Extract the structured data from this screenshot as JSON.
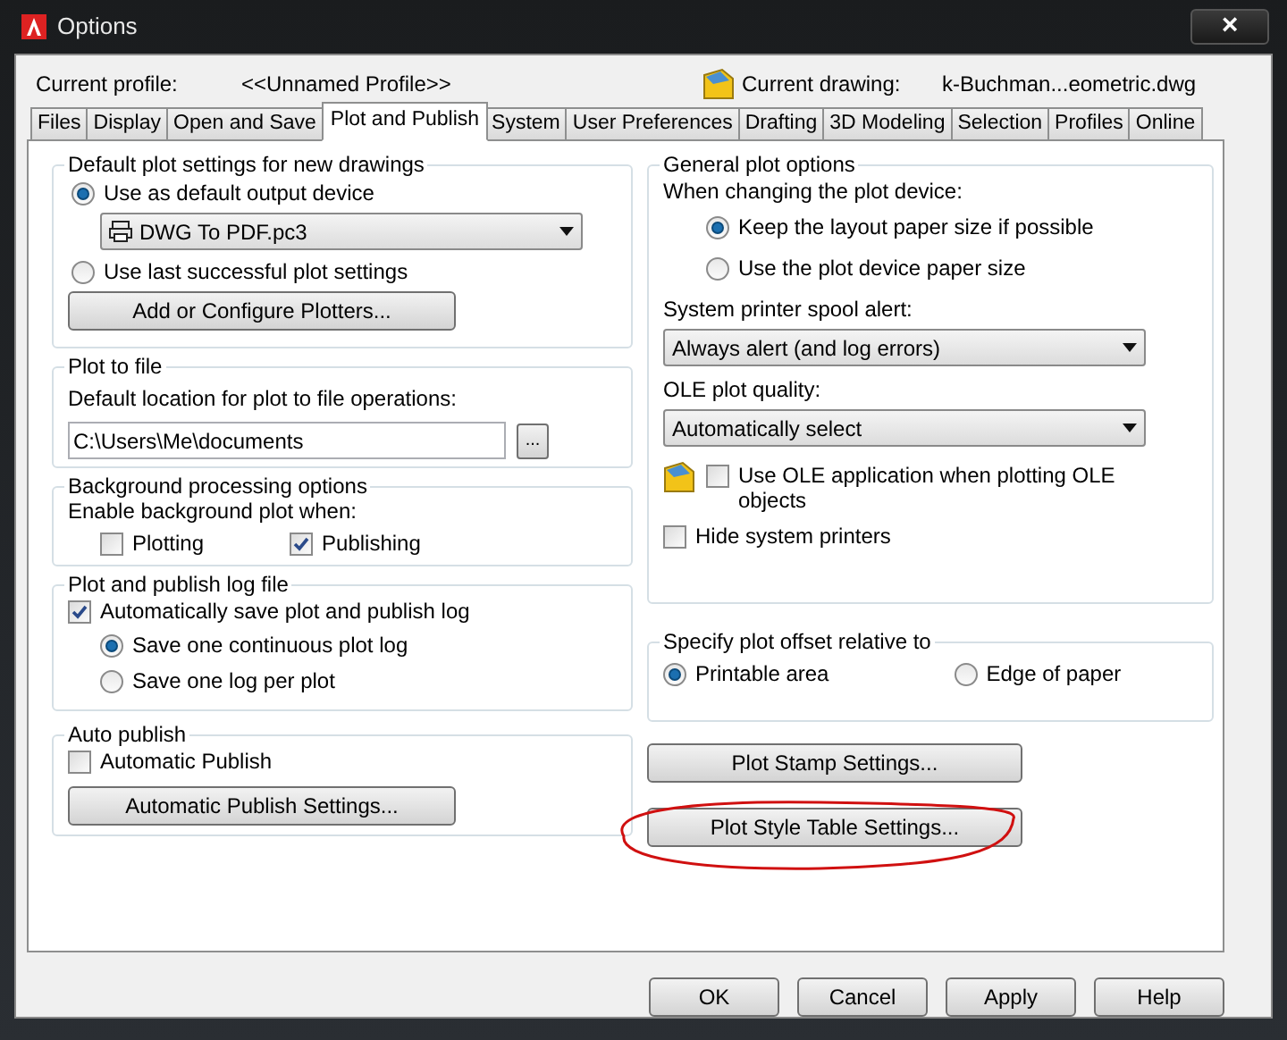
{
  "window": {
    "title": "Options",
    "close": "×"
  },
  "profile": {
    "label": "Current profile:",
    "value": "<<Unnamed Profile>>"
  },
  "drawing": {
    "label": "Current drawing:",
    "value": "k-Buchman...eometric.dwg"
  },
  "tabs": [
    {
      "label": "Files",
      "selected": false
    },
    {
      "label": "Display",
      "selected": false
    },
    {
      "label": "Open and Save",
      "selected": false
    },
    {
      "label": "Plot and Publish",
      "selected": true
    },
    {
      "label": "System",
      "selected": false
    },
    {
      "label": "User Preferences",
      "selected": false
    },
    {
      "label": "Drafting",
      "selected": false
    },
    {
      "label": "3D Modeling",
      "selected": false
    },
    {
      "label": "Selection",
      "selected": false
    },
    {
      "label": "Profiles",
      "selected": false
    },
    {
      "label": "Online",
      "selected": false
    }
  ],
  "default_plot": {
    "title": "Default plot settings for new drawings",
    "options": [
      {
        "label": "Use as default output device",
        "selected": true
      },
      {
        "label": "Use last successful plot settings",
        "selected": false
      }
    ],
    "device": "DWG To PDF.pc3",
    "button": "Add or Configure Plotters..."
  },
  "plot_to_file": {
    "title": "Plot to file",
    "label": "Default location for plot to file operations:",
    "value": "C:\\Users\\Me\\documents",
    "browse": "..."
  },
  "background": {
    "title": "Background processing options",
    "label": "Enable background plot when:",
    "checks": [
      {
        "label": "Plotting",
        "checked": false
      },
      {
        "label": "Publishing",
        "checked": true
      }
    ]
  },
  "log": {
    "title": "Plot and publish log file",
    "auto_save": {
      "label": "Automatically save plot and publish log",
      "checked": true
    },
    "options": [
      {
        "label": "Save one continuous plot log",
        "selected": true
      },
      {
        "label": "Save one log per plot",
        "selected": false
      }
    ]
  },
  "auto_publish": {
    "title": "Auto publish",
    "check": {
      "label": "Automatic Publish",
      "checked": false
    },
    "button": "Automatic Publish Settings..."
  },
  "general": {
    "title": "General plot options",
    "device_label": "When changing the plot device:",
    "device_options": [
      {
        "label": "Keep the layout paper size if possible",
        "selected": true
      },
      {
        "label": "Use the plot device paper size",
        "selected": false
      }
    ],
    "spool_label": "System printer spool alert:",
    "spool_value": "Always alert (and log errors)",
    "ole_label": "OLE plot quality:",
    "ole_value": "Automatically select",
    "ole_app": {
      "label": "Use OLE application when plotting OLE objects",
      "checked": false
    },
    "hide_printers": {
      "label": "Hide system printers",
      "checked": false
    }
  },
  "offset": {
    "title": "Specify plot offset relative to",
    "options": [
      {
        "label": "Printable area",
        "selected": true
      },
      {
        "label": "Edge of paper",
        "selected": false
      }
    ]
  },
  "side_buttons": [
    "Plot Stamp Settings...",
    "Plot Style Table Settings..."
  ],
  "footer_buttons": [
    "OK",
    "Cancel",
    "Apply",
    "Help"
  ]
}
